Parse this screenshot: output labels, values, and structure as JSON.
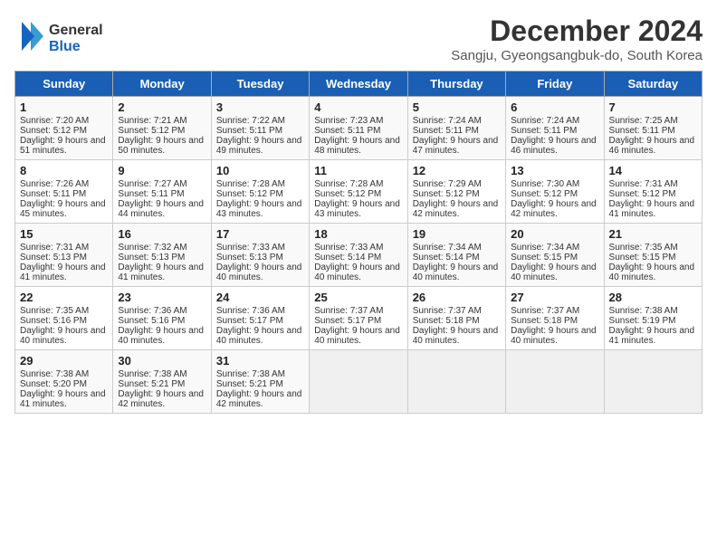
{
  "header": {
    "logo_general": "General",
    "logo_blue": "Blue",
    "month": "December 2024",
    "location": "Sangju, Gyeongsangbuk-do, South Korea"
  },
  "days_of_week": [
    "Sunday",
    "Monday",
    "Tuesday",
    "Wednesday",
    "Thursday",
    "Friday",
    "Saturday"
  ],
  "weeks": [
    [
      {
        "day": "1",
        "sunrise": "Sunrise: 7:20 AM",
        "sunset": "Sunset: 5:12 PM",
        "daylight": "Daylight: 9 hours and 51 minutes."
      },
      {
        "day": "2",
        "sunrise": "Sunrise: 7:21 AM",
        "sunset": "Sunset: 5:12 PM",
        "daylight": "Daylight: 9 hours and 50 minutes."
      },
      {
        "day": "3",
        "sunrise": "Sunrise: 7:22 AM",
        "sunset": "Sunset: 5:11 PM",
        "daylight": "Daylight: 9 hours and 49 minutes."
      },
      {
        "day": "4",
        "sunrise": "Sunrise: 7:23 AM",
        "sunset": "Sunset: 5:11 PM",
        "daylight": "Daylight: 9 hours and 48 minutes."
      },
      {
        "day": "5",
        "sunrise": "Sunrise: 7:24 AM",
        "sunset": "Sunset: 5:11 PM",
        "daylight": "Daylight: 9 hours and 47 minutes."
      },
      {
        "day": "6",
        "sunrise": "Sunrise: 7:24 AM",
        "sunset": "Sunset: 5:11 PM",
        "daylight": "Daylight: 9 hours and 46 minutes."
      },
      {
        "day": "7",
        "sunrise": "Sunrise: 7:25 AM",
        "sunset": "Sunset: 5:11 PM",
        "daylight": "Daylight: 9 hours and 46 minutes."
      }
    ],
    [
      {
        "day": "8",
        "sunrise": "Sunrise: 7:26 AM",
        "sunset": "Sunset: 5:11 PM",
        "daylight": "Daylight: 9 hours and 45 minutes."
      },
      {
        "day": "9",
        "sunrise": "Sunrise: 7:27 AM",
        "sunset": "Sunset: 5:11 PM",
        "daylight": "Daylight: 9 hours and 44 minutes."
      },
      {
        "day": "10",
        "sunrise": "Sunrise: 7:28 AM",
        "sunset": "Sunset: 5:12 PM",
        "daylight": "Daylight: 9 hours and 43 minutes."
      },
      {
        "day": "11",
        "sunrise": "Sunrise: 7:28 AM",
        "sunset": "Sunset: 5:12 PM",
        "daylight": "Daylight: 9 hours and 43 minutes."
      },
      {
        "day": "12",
        "sunrise": "Sunrise: 7:29 AM",
        "sunset": "Sunset: 5:12 PM",
        "daylight": "Daylight: 9 hours and 42 minutes."
      },
      {
        "day": "13",
        "sunrise": "Sunrise: 7:30 AM",
        "sunset": "Sunset: 5:12 PM",
        "daylight": "Daylight: 9 hours and 42 minutes."
      },
      {
        "day": "14",
        "sunrise": "Sunrise: 7:31 AM",
        "sunset": "Sunset: 5:12 PM",
        "daylight": "Daylight: 9 hours and 41 minutes."
      }
    ],
    [
      {
        "day": "15",
        "sunrise": "Sunrise: 7:31 AM",
        "sunset": "Sunset: 5:13 PM",
        "daylight": "Daylight: 9 hours and 41 minutes."
      },
      {
        "day": "16",
        "sunrise": "Sunrise: 7:32 AM",
        "sunset": "Sunset: 5:13 PM",
        "daylight": "Daylight: 9 hours and 41 minutes."
      },
      {
        "day": "17",
        "sunrise": "Sunrise: 7:33 AM",
        "sunset": "Sunset: 5:13 PM",
        "daylight": "Daylight: 9 hours and 40 minutes."
      },
      {
        "day": "18",
        "sunrise": "Sunrise: 7:33 AM",
        "sunset": "Sunset: 5:14 PM",
        "daylight": "Daylight: 9 hours and 40 minutes."
      },
      {
        "day": "19",
        "sunrise": "Sunrise: 7:34 AM",
        "sunset": "Sunset: 5:14 PM",
        "daylight": "Daylight: 9 hours and 40 minutes."
      },
      {
        "day": "20",
        "sunrise": "Sunrise: 7:34 AM",
        "sunset": "Sunset: 5:15 PM",
        "daylight": "Daylight: 9 hours and 40 minutes."
      },
      {
        "day": "21",
        "sunrise": "Sunrise: 7:35 AM",
        "sunset": "Sunset: 5:15 PM",
        "daylight": "Daylight: 9 hours and 40 minutes."
      }
    ],
    [
      {
        "day": "22",
        "sunrise": "Sunrise: 7:35 AM",
        "sunset": "Sunset: 5:16 PM",
        "daylight": "Daylight: 9 hours and 40 minutes."
      },
      {
        "day": "23",
        "sunrise": "Sunrise: 7:36 AM",
        "sunset": "Sunset: 5:16 PM",
        "daylight": "Daylight: 9 hours and 40 minutes."
      },
      {
        "day": "24",
        "sunrise": "Sunrise: 7:36 AM",
        "sunset": "Sunset: 5:17 PM",
        "daylight": "Daylight: 9 hours and 40 minutes."
      },
      {
        "day": "25",
        "sunrise": "Sunrise: 7:37 AM",
        "sunset": "Sunset: 5:17 PM",
        "daylight": "Daylight: 9 hours and 40 minutes."
      },
      {
        "day": "26",
        "sunrise": "Sunrise: 7:37 AM",
        "sunset": "Sunset: 5:18 PM",
        "daylight": "Daylight: 9 hours and 40 minutes."
      },
      {
        "day": "27",
        "sunrise": "Sunrise: 7:37 AM",
        "sunset": "Sunset: 5:18 PM",
        "daylight": "Daylight: 9 hours and 40 minutes."
      },
      {
        "day": "28",
        "sunrise": "Sunrise: 7:38 AM",
        "sunset": "Sunset: 5:19 PM",
        "daylight": "Daylight: 9 hours and 41 minutes."
      }
    ],
    [
      {
        "day": "29",
        "sunrise": "Sunrise: 7:38 AM",
        "sunset": "Sunset: 5:20 PM",
        "daylight": "Daylight: 9 hours and 41 minutes."
      },
      {
        "day": "30",
        "sunrise": "Sunrise: 7:38 AM",
        "sunset": "Sunset: 5:21 PM",
        "daylight": "Daylight: 9 hours and 42 minutes."
      },
      {
        "day": "31",
        "sunrise": "Sunrise: 7:38 AM",
        "sunset": "Sunset: 5:21 PM",
        "daylight": "Daylight: 9 hours and 42 minutes."
      },
      {
        "day": "",
        "sunrise": "",
        "sunset": "",
        "daylight": ""
      },
      {
        "day": "",
        "sunrise": "",
        "sunset": "",
        "daylight": ""
      },
      {
        "day": "",
        "sunrise": "",
        "sunset": "",
        "daylight": ""
      },
      {
        "day": "",
        "sunrise": "",
        "sunset": "",
        "daylight": ""
      }
    ]
  ]
}
